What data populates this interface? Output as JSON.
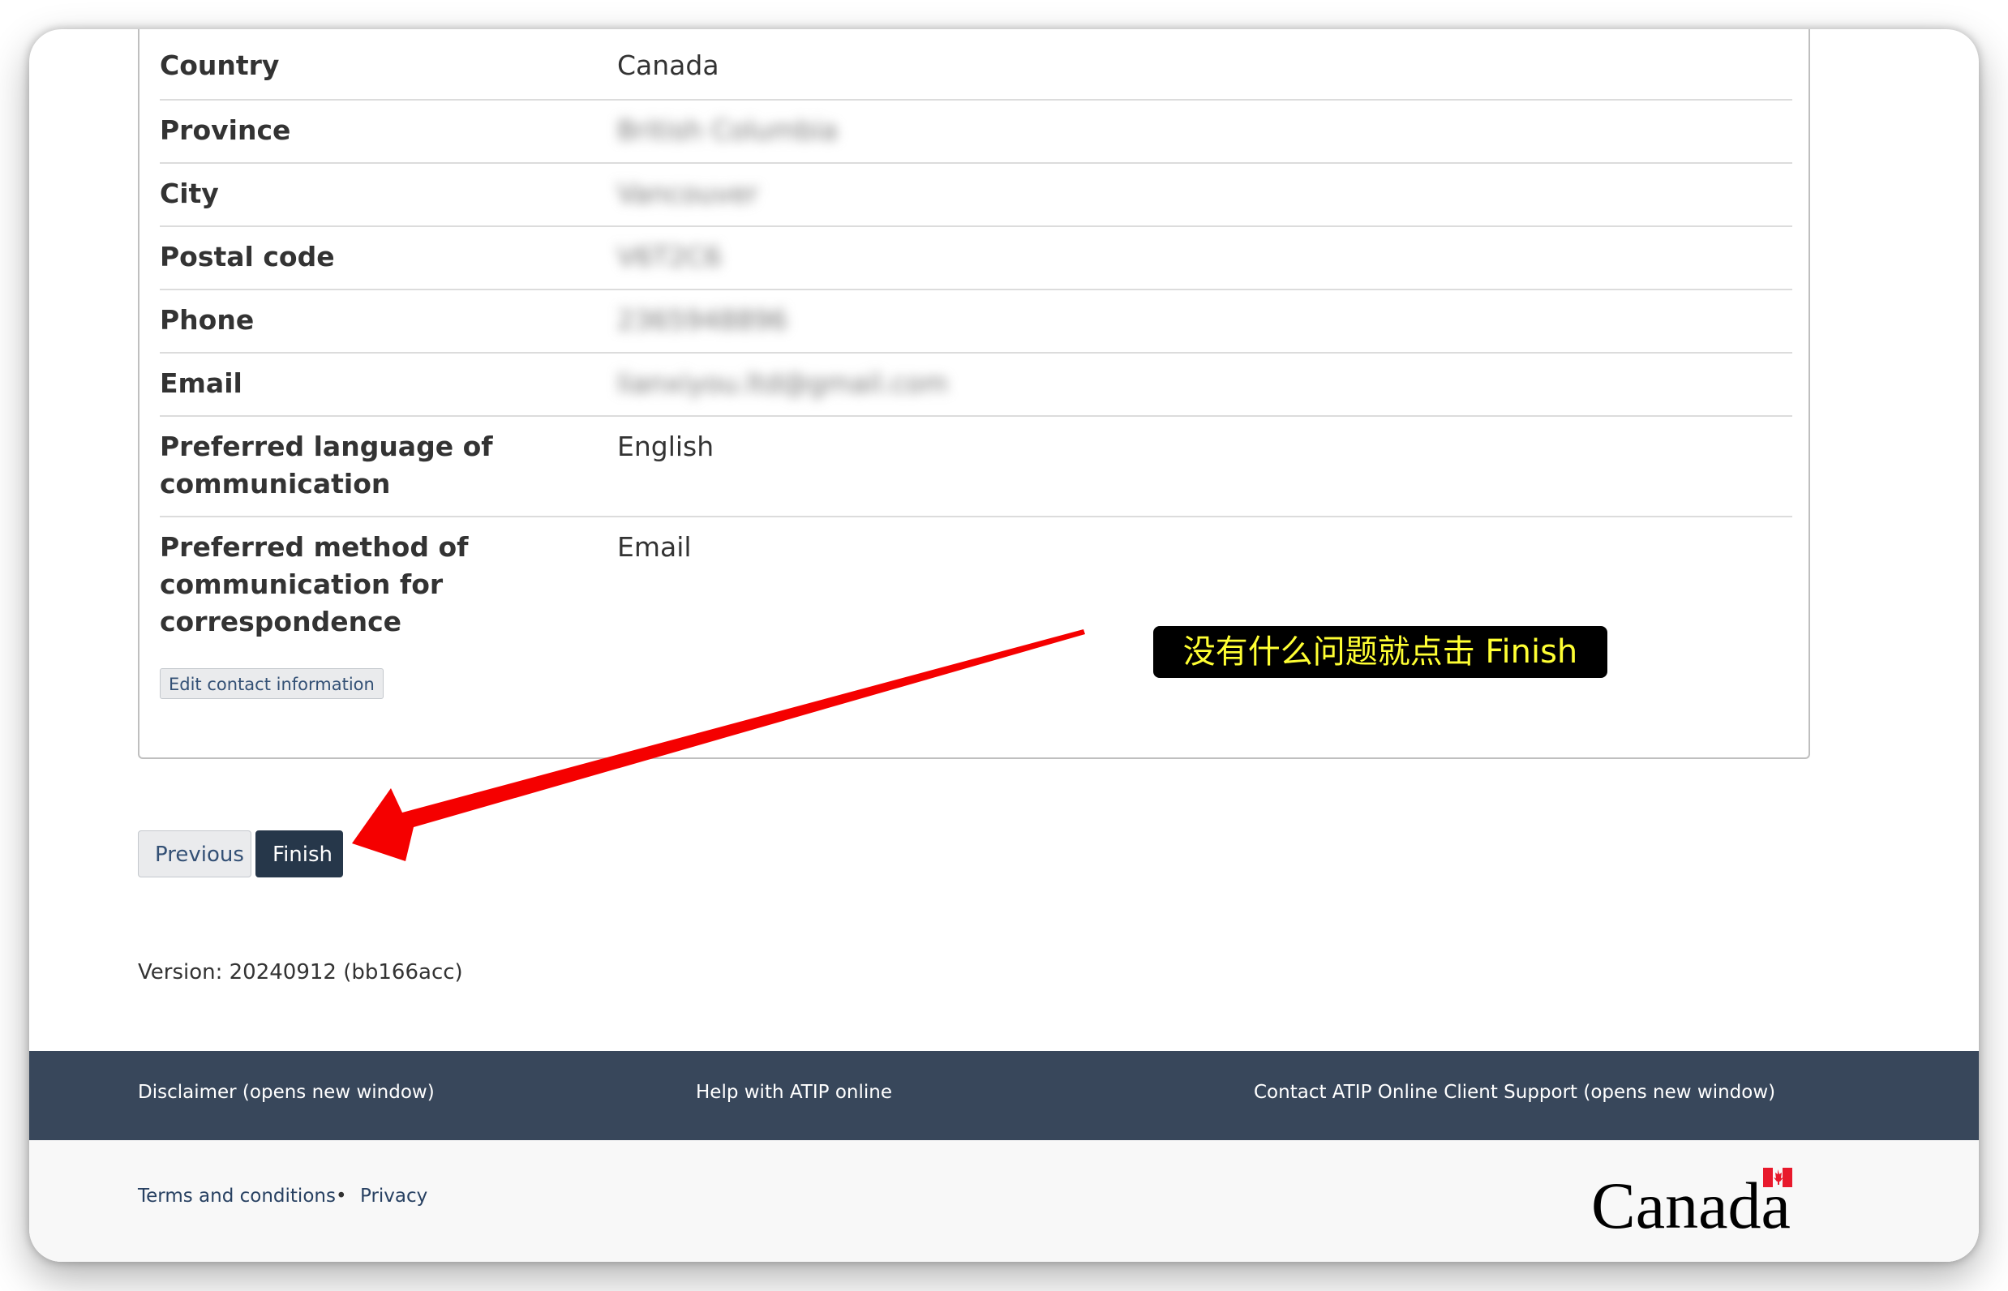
{
  "details": {
    "rows": [
      {
        "label": "Country",
        "value": "Canada",
        "blurred": false
      },
      {
        "label": "Province",
        "value": "British Columbia",
        "blurred": true
      },
      {
        "label": "City",
        "value": "Vancouver",
        "blurred": true
      },
      {
        "label": "Postal code",
        "value": "V6T2C6",
        "blurred": true
      },
      {
        "label": "Phone",
        "value": "2365948896",
        "blurred": true
      },
      {
        "label": "Email",
        "value": "lianxiyou.ltd@gmail.com",
        "blurred": true
      },
      {
        "label": "Preferred language of communication",
        "value": "English",
        "blurred": false
      },
      {
        "label": "Preferred method of communication for correspondence",
        "value": "Email",
        "blurred": false
      }
    ],
    "edit_button": "Edit contact information"
  },
  "nav": {
    "previous": "Previous",
    "finish": "Finish"
  },
  "version": "Version: 20240912 (bb166acc)",
  "footer": {
    "disclaimer": "Disclaimer (opens new window)",
    "help": "Help with ATIP online",
    "contact": "Contact ATIP Online Client Support (opens new window)",
    "terms": "Terms and conditions",
    "separator": "•",
    "privacy": "Privacy",
    "wordmark": "Canada"
  },
  "annotation": {
    "text": "没有什么问题就点击 Finish",
    "arrow_color": "#f50000",
    "box_color": "#000000",
    "text_color": "#ffff33"
  }
}
